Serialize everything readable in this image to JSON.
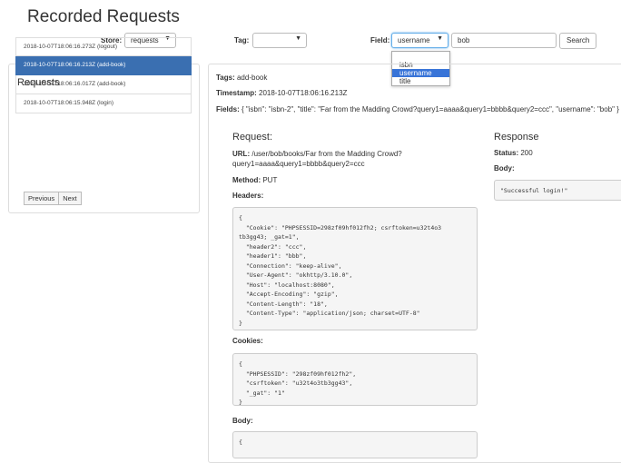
{
  "page_title": "Recorded Requests",
  "store": {
    "label": "Store:",
    "value": "requests"
  },
  "tag": {
    "label": "Tag:",
    "value": ""
  },
  "field": {
    "label": "Field:",
    "value": "username",
    "options": [
      "isbn",
      "username",
      "title"
    ]
  },
  "search": {
    "value": "bob",
    "button": "Search"
  },
  "requests_panel": {
    "title": "Requests",
    "items": [
      "2018-10-07T18:06:16.273Z (logout)",
      "2018-10-07T18:06:16.213Z (add-book)",
      "2018-10-07T18:06:16.017Z (add-book)",
      "2018-10-07T18:06:15.948Z (login)"
    ],
    "active_index": 1,
    "prev": "Previous",
    "next": "Next"
  },
  "detail": {
    "tags_label": "Tags:",
    "tags": "add-book",
    "timestamp_label": "Timestamp:",
    "timestamp": "2018-10-07T18:06:16.213Z",
    "fields_label": "Fields:",
    "fields": "{ \"isbn\": \"isbn-2\", \"title\": \"Far from the Madding Crowd?query1=aaaa&query1=bbbb&query2=ccc\", \"username\": \"bob\" }",
    "request": {
      "title": "Request:",
      "url_label": "URL:",
      "url_line1": "/user/bob/books/Far from the Madding Crowd?",
      "url_line2": "query1=aaaa&query1=bbbb&query2=ccc",
      "method_label": "Method:",
      "method": "PUT",
      "headers_label": "Headers:",
      "headers": "{\n  \"Cookie\": \"PHPSESSID=298zf09hf012fh2; csrftoken=u32t4o3\ntb3gg43; _gat=1\",\n  \"header2\": \"ccc\",\n  \"header1\": \"bbb\",\n  \"Connection\": \"keep-alive\",\n  \"User-Agent\": \"okhttp/3.10.0\",\n  \"Host\": \"localhost:8080\",\n  \"Accept-Encoding\": \"gzip\",\n  \"Content-Length\": \"18\",\n  \"Content-Type\": \"application/json; charset=UTF-8\"\n}",
      "cookies_label": "Cookies:",
      "cookies": "{\n  \"PHPSESSID\": \"298zf09hf012fh2\",\n  \"csrftoken\": \"u32t4o3tb3gg43\",\n  \"_gat\": \"1\"\n}",
      "body_label": "Body:",
      "body": "{"
    },
    "response": {
      "title": "Response",
      "status_label": "Status:",
      "status": "200",
      "body_label": "Body:",
      "body": "\"Successful login!\""
    }
  },
  "colors": {
    "active": "#3a6fb1",
    "option_highlight": "#3874d8",
    "focus": "#66afe9"
  }
}
